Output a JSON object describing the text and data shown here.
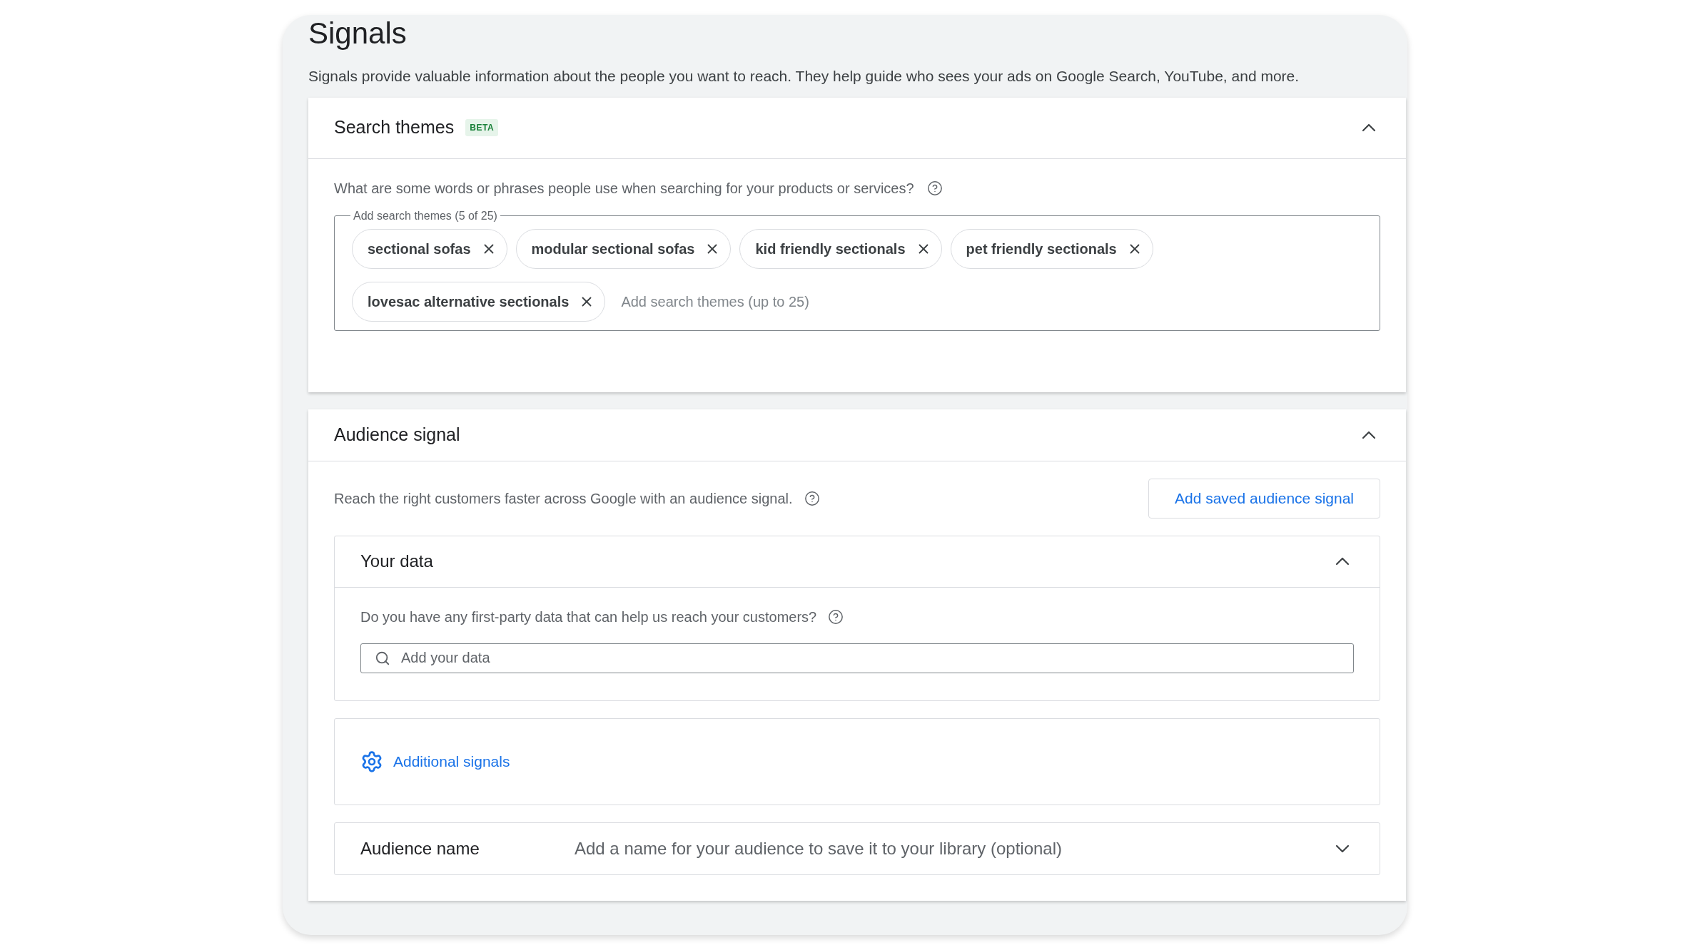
{
  "title": "Signals",
  "description": "Signals provide valuable information about the people you want to reach. They help guide who sees your ads on Google Search, YouTube, and more.",
  "search_themes": {
    "title": "Search themes",
    "badge": "BETA",
    "expanded": true,
    "question": "What are some words or phrases people use when searching for your products or services?",
    "field_label": "Add search themes (5 of 25)",
    "chips": [
      {
        "label": "sectional sofas"
      },
      {
        "label": "modular sectional sofas"
      },
      {
        "label": "kid friendly sectionals"
      },
      {
        "label": "pet friendly sectionals"
      },
      {
        "label": "lovesac alternative sectionals"
      }
    ],
    "placeholder": "Add search themes (up to 25)"
  },
  "audience_signal": {
    "title": "Audience signal",
    "expanded": true,
    "description": "Reach the right customers faster across Google with an audience signal.",
    "button": "Add saved audience signal",
    "your_data": {
      "title": "Your data",
      "expanded": true,
      "question": "Do you have any first-party data that can help us reach your customers?",
      "placeholder": "Add your data"
    },
    "additional_signals": "Additional signals",
    "audience_name": {
      "label": "Audience name",
      "placeholder": "Add a name for your audience to save it to your library (optional)",
      "expanded": false
    }
  }
}
